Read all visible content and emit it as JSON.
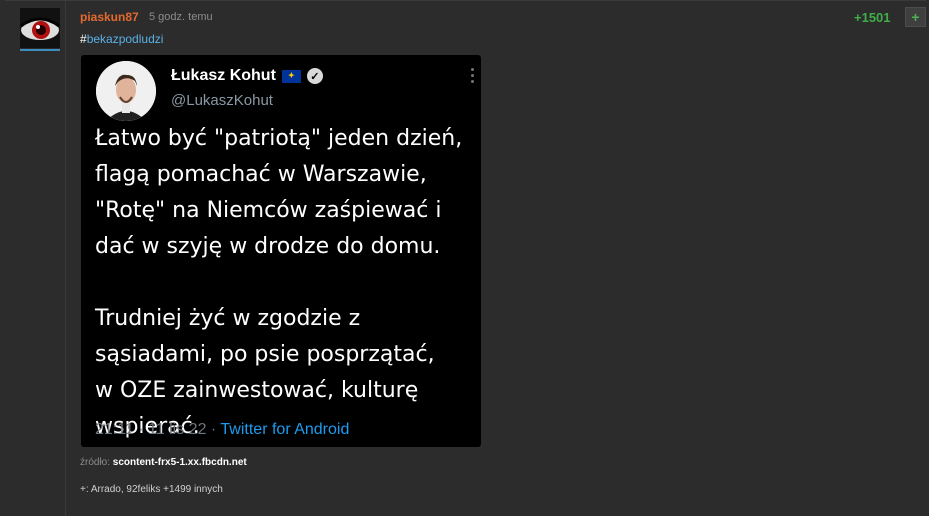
{
  "entry": {
    "author": "piaskun87",
    "time": "5 godz. temu",
    "score": "+1501",
    "plus_label": "+",
    "tag_hash": "#",
    "tag_name": "bekazpodludzi"
  },
  "tweet": {
    "name": "Łukasz Kohut",
    "flag_icon": "eu-flag-icon",
    "verified_icon": "verified-badge-icon",
    "handle": "@LukaszKohut",
    "text": "Łatwo być \"patriotą\" jeden dzień,\nflagą pomachać w Warszawie,\n\"Rotę\" na Niemców zaśpiewać i\ndać w szyję w drodze do domu.\n\nTrudniej żyć w zgodzie z\nsąsiadami, po psie posprzątać,\nw OZE zainwestować, kulturę\nwspierać.",
    "timestamp": "21:11 · 11 lis 22 · ",
    "client": "Twitter for Android"
  },
  "footer": {
    "source_label": "źródło: ",
    "source_link": "scontent-frx5-1.xx.fbcdn.net",
    "voters": "+: Arrado, 92feliks +1499 innych"
  },
  "colors": {
    "background": "#2c2c2c",
    "author": "#e5692d",
    "score": "#3fae49",
    "tag": "#5ab1e6",
    "tweet_link": "#1d9bf0"
  }
}
